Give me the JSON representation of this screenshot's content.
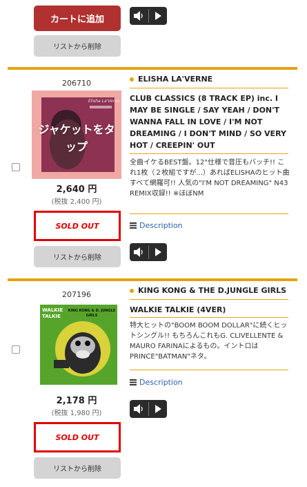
{
  "top": {
    "cart_label": "カートに追加",
    "remove_label": "リストから削除"
  },
  "items": [
    {
      "item_no": "206710",
      "jacket_overlay": "ジャケットをタップ",
      "jacket_text_artist": "Elisha La'Verne",
      "price": "2,640 円",
      "price_tax": "(税抜 2,400 円)",
      "sold_out": "SOLD OUT",
      "remove_label": "リストから削除",
      "artist": "ELISHA LA'VERNE",
      "title": "CLUB CLASSICS (8 TRACK EP) inc. I MAY BE SINGLE / SAY YEAH / DON'T WANNA FALL IN LOVE / I'M NOT DREAMING / I DON'T MIND / SO VERY HOT / CREEPIN' OUT",
      "description": "全曲イケるBEST盤。12\"仕様で音圧もバッチ!! これ1枚（２枚組ですが...）あればELISHAのヒット曲 すべて網羅可!! 人気の\"I'M NOT DREAMING\" N43 REMIX収録!! ※ほぼNM",
      "desc_link": "Description"
    },
    {
      "item_no": "207196",
      "jacket_text_artist": "KING KONG & D. JUNGLE GIRLS",
      "jacket_text_title": "WALKIE TALKIE",
      "price": "2,178 円",
      "price_tax": "(税抜 1,980 円)",
      "sold_out": "SOLD OUT",
      "remove_label": "リストから削除",
      "artist": "KING KONG & THE D.JUNGLE GIRLS",
      "title": "WALKIE TALKIE (4VER)",
      "description": "特大ヒットの\"BOOM BOOM DOLLAR\"に続くヒットシングル!! もちろんこれもG. CLIVELLENTE & MAURO FARINAによるもの。イントロはPRINCE\"BATMAN\"ネタ。",
      "desc_link": "Description"
    }
  ],
  "colors": {
    "accent": "#e7a20f",
    "cart_button": "#b0312f",
    "sold_out": "#e00000",
    "link": "#2a5fb0"
  }
}
